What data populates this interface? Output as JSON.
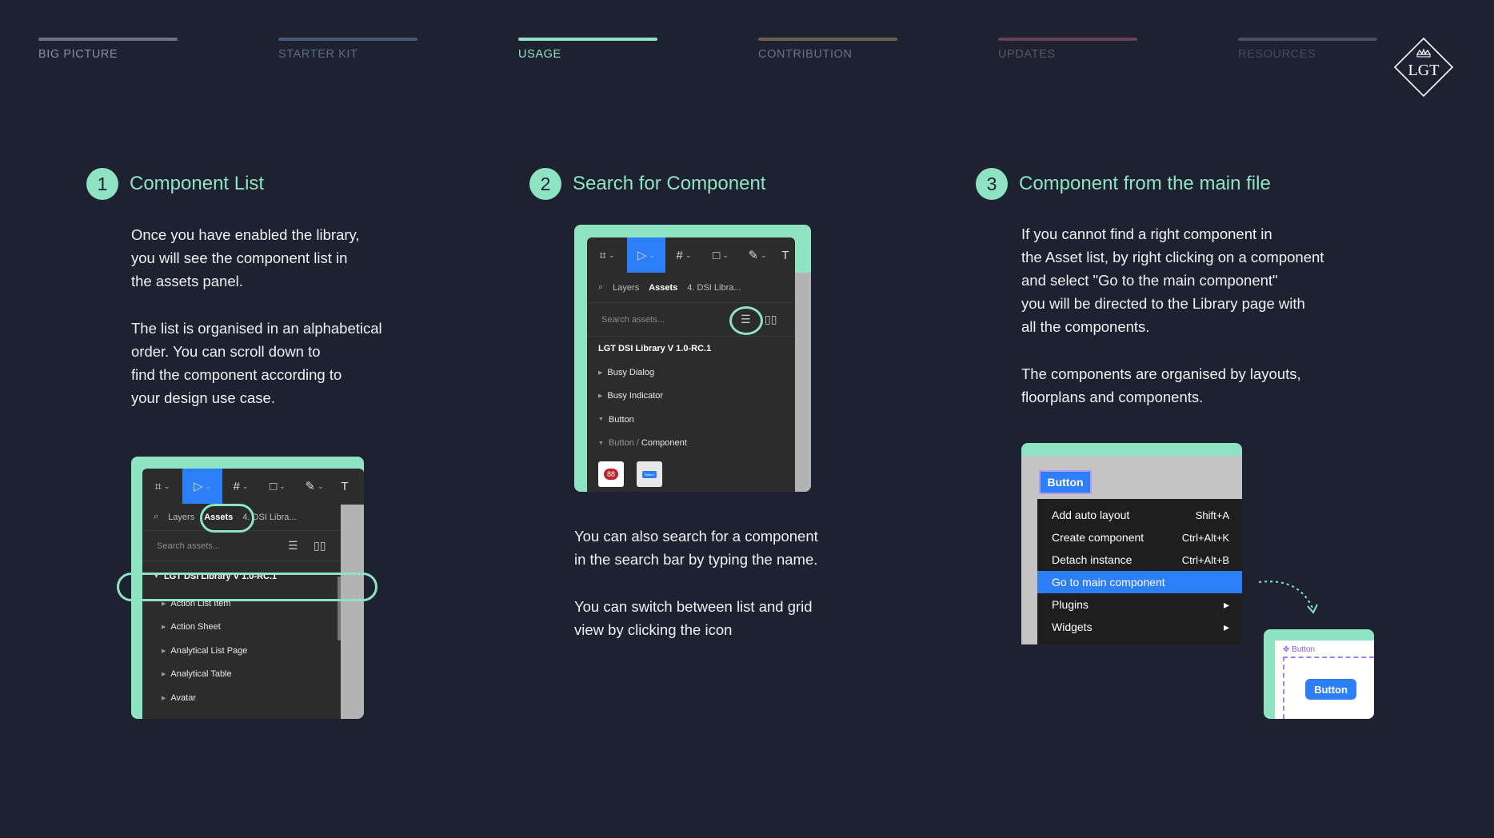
{
  "nav": [
    {
      "label": "BIG PICTURE",
      "bar": "#6e7384",
      "text": "#8a8f9e"
    },
    {
      "label": "STARTER KIT",
      "bar": "#47597a",
      "text": "#5d6a86"
    },
    {
      "label": "USAGE",
      "bar": "#8ee3c3",
      "text": "#8ee3c3"
    },
    {
      "label": "CONTRIBUTION",
      "bar": "#6a6050",
      "text": "#6c7180"
    },
    {
      "label": "UPDATES",
      "bar": "#6a3f5a",
      "text": "#5d5466"
    },
    {
      "label": "RESOURCES",
      "bar": "#4a4f5f",
      "text": "#464b5a"
    }
  ],
  "logo": {
    "text": "LGT"
  },
  "section1": {
    "num": "1",
    "title": "Component List",
    "para1": "Once you have enabled the library,\nyou will see the component list in\nthe assets panel.",
    "para2": "The list is organised in an alphabetical\norder. You can scroll down to\nfind the component according to\nyour design use case."
  },
  "section2": {
    "num": "2",
    "title": "Search for Component",
    "para1": "You can also search for a component\nin the search bar by typing the name.",
    "para2": "You can switch between list and grid\nview by clicking the icon"
  },
  "section3": {
    "num": "3",
    "title": "Component from the main file",
    "para1": "If you cannot find a right component in\nthe Asset list, by right clicking on a component\nand select \"Go to the main component\"\nyou will be directed  to the Library page with\nall the components.",
    "para2": "The components are organised by layouts,\nfloorplans and components."
  },
  "mock1": {
    "tab_layers": "Layers",
    "tab_assets": "Assets",
    "library_select": "4. DSI Libra...",
    "search_placeholder": "Search assets...",
    "library_title": "LGT DSI Library V 1.0-RC.1",
    "items": [
      "Action List Item",
      "Action Sheet",
      "Analytical List Page",
      "Analytical Table",
      "Avatar"
    ]
  },
  "mock2": {
    "tab_layers": "Layers",
    "tab_assets": "Assets",
    "library_select": "4. DSI Libra...",
    "search_placeholder": "Search assets...",
    "library_title": "LGT DSI Library V 1.0-RC.1",
    "items": [
      "Busy Dialog",
      "Busy Indicator",
      "Button"
    ],
    "path_parent": "Button",
    "path_sep": " / ",
    "path_child": "Component",
    "thumb_badge": "88",
    "thumb_button": "Button"
  },
  "mock3": {
    "selected_button": "Button",
    "menu": [
      {
        "label": "Add auto layout",
        "shortcut": "Shift+A"
      },
      {
        "label": "Create component",
        "shortcut": "Ctrl+Alt+K"
      },
      {
        "label": "Detach instance",
        "shortcut": "Ctrl+Alt+B"
      },
      {
        "label": "Go to main component",
        "shortcut": ""
      },
      {
        "label": "Plugins",
        "shortcut": "▸"
      },
      {
        "label": "Widgets",
        "shortcut": "▸"
      }
    ],
    "result_label": "Button",
    "result_button": "Button"
  }
}
